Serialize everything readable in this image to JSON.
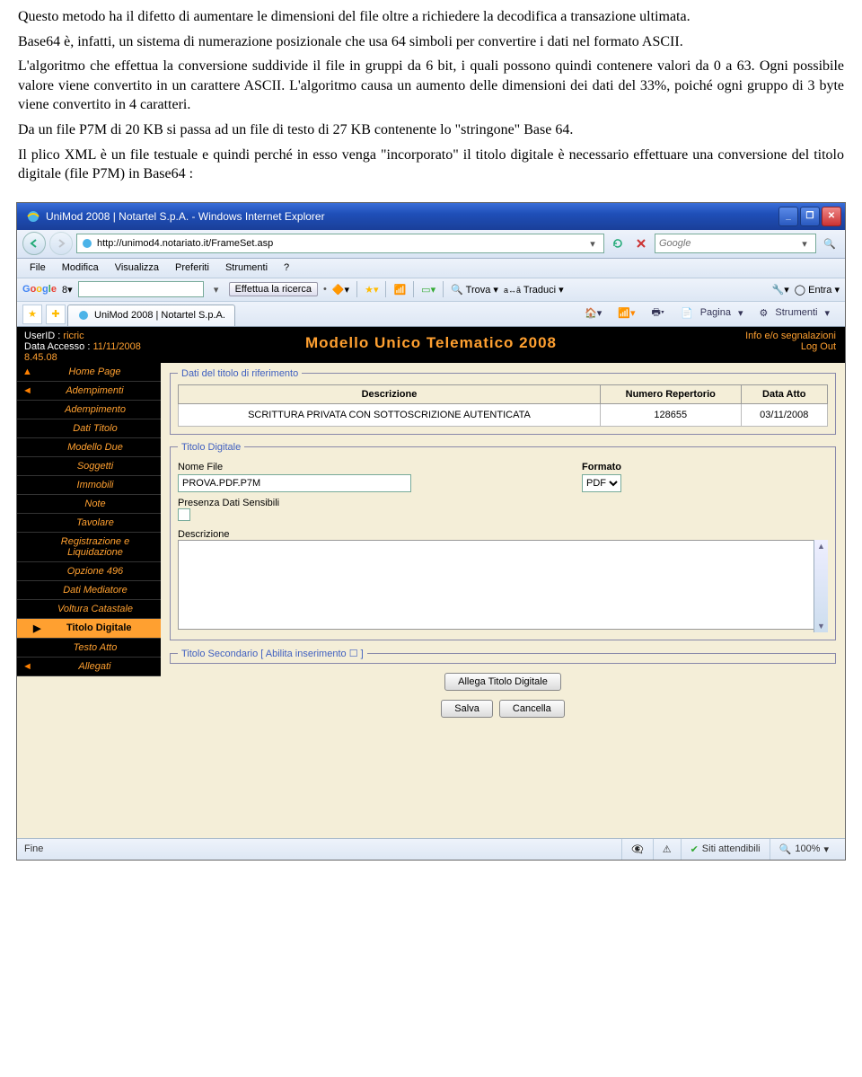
{
  "doc": {
    "p1": "Questo metodo ha il difetto di aumentare le dimensioni del file oltre a richiedere la decodifica a transazione ultimata.",
    "p2": "Base64 è, infatti, un sistema di numerazione posizionale che usa 64 simboli per convertire i dati nel formato ASCII.",
    "p3": "L'algoritmo che effettua la conversione suddivide il file in gruppi da 6 bit, i quali possono quindi contenere valori da 0 a 63. Ogni possibile valore viene convertito in un carattere ASCII. L'algoritmo causa un aumento delle dimensioni dei dati del 33%, poiché ogni gruppo di 3 byte viene convertito in 4 caratteri.",
    "p4": "Da un file P7M di 20 KB si passa ad un file di testo di 27 KB contenente lo \"stringone\" Base 64.",
    "p5": "Il plico XML è un file testuale e quindi perché in esso venga \"incorporato\" il titolo digitale è necessario effettuare una conversione del titolo digitale (file P7M) in Base64 :"
  },
  "window": {
    "title": "UniMod 2008 | Notartel S.p.A. - Windows Internet Explorer",
    "url": "http://unimod4.notariato.it/FrameSet.asp",
    "search_placeholder": "Google"
  },
  "menus": [
    "File",
    "Modifica",
    "Visualizza",
    "Preferiti",
    "Strumenti",
    "?"
  ],
  "googlebar": {
    "brand": "Google",
    "search": "Effettua la ricerca",
    "trova": "Trova",
    "traduci": "Traduci",
    "entra": "Entra"
  },
  "tab": {
    "label": "UniMod 2008 | Notartel S.p.A.",
    "home": "",
    "feed": "",
    "print": "",
    "pagina": "Pagina",
    "strumenti": "Strumenti"
  },
  "header": {
    "userid_lbl": "UserID :",
    "userid": "ricric",
    "access_lbl": "Data Accesso :",
    "access": "11/11/2008 8.45.08",
    "title": "Modello Unico Telematico 2008",
    "info": "Info e/o segnalazioni",
    "logout": "Log Out"
  },
  "sidebar": [
    {
      "label": "Home Page",
      "mark": "▲"
    },
    {
      "label": "Adempimenti",
      "mark": "◄"
    },
    {
      "label": "Adempimento"
    },
    {
      "label": "Dati Titolo"
    },
    {
      "label": "Modello Due"
    },
    {
      "label": "Soggetti"
    },
    {
      "label": "Immobili"
    },
    {
      "label": "Note"
    },
    {
      "label": "Tavolare"
    },
    {
      "label": "Registrazione e Liquidazione"
    },
    {
      "label": "Opzione 496"
    },
    {
      "label": "Dati Mediatore"
    },
    {
      "label": "Voltura Catastale"
    },
    {
      "label": "Titolo Digitale",
      "active": true,
      "mark": "▶"
    },
    {
      "label": "Testo Atto"
    },
    {
      "label": "Allegati",
      "mark": "◄"
    }
  ],
  "fsDati": {
    "legend": "Dati del titolo di riferimento",
    "cols": [
      "Descrizione",
      "Numero Repertorio",
      "Data Atto"
    ],
    "row": [
      "SCRITTURA PRIVATA CON SOTTOSCRIZIONE AUTENTICATA",
      "128655",
      "03/11/2008"
    ]
  },
  "fsTitolo": {
    "legend": "Titolo Digitale",
    "nomefile_lbl": "Nome File",
    "nomefile": "PROVA.PDF.P7M",
    "formato_lbl": "Formato",
    "formato": "PDF",
    "presenza_lbl": "Presenza Dati Sensibili",
    "desc_lbl": "Descrizione"
  },
  "fsSec": {
    "legend": "Titolo Secondario [ Abilita inserimento ☐ ]"
  },
  "buttons": {
    "allega": "Allega Titolo Digitale",
    "salva": "Salva",
    "cancella": "Cancella"
  },
  "status": {
    "left": "Fine",
    "trusted": "Siti attendibili",
    "zoom": "100%"
  }
}
